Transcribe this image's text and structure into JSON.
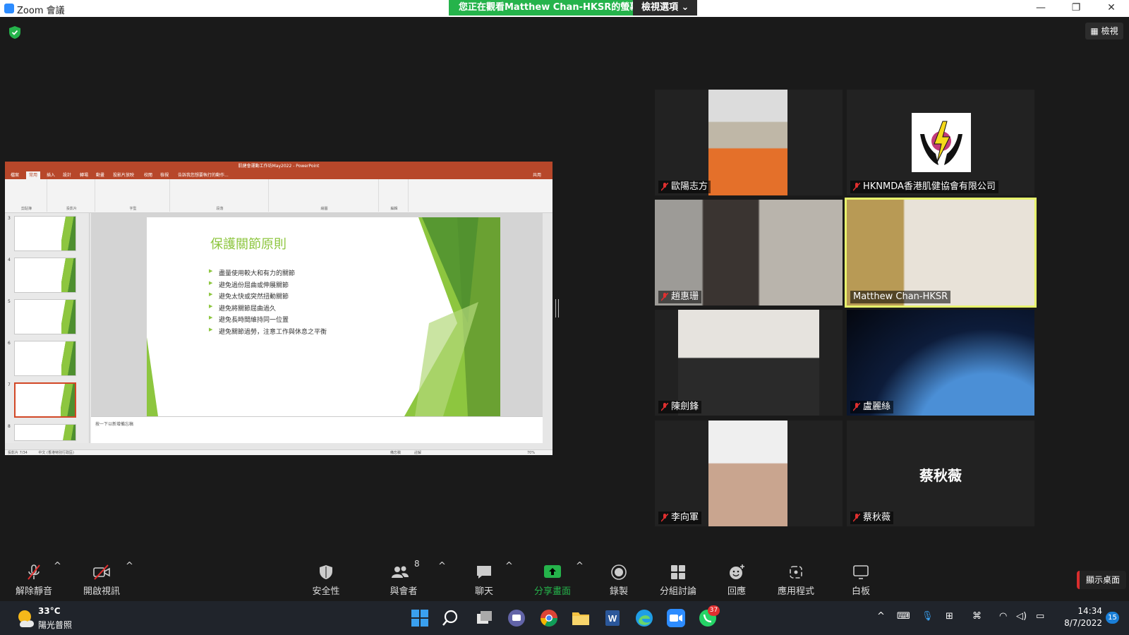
{
  "window": {
    "title": "Zoom 會議",
    "share_banner": "您正在觀看Matthew  Chan-HKSR的螢幕",
    "view_options": "檢視選項",
    "view_button": "檢視"
  },
  "shared_screen": {
    "window_title": "肌健會運動工作坊May2022 - PowerPoint",
    "tabs": [
      "檔案",
      "常用",
      "插入",
      "設計",
      "轉場",
      "動畫",
      "投影片放映",
      "校閱",
      "檢視"
    ],
    "active_tab": "常用",
    "tell_me": "告訴我您想要執行的動作...",
    "share_label": "共用",
    "ribbon_groups": [
      "剪貼簿",
      "投影片",
      "字型",
      "段落",
      "繪圖",
      "編輯"
    ],
    "slide_numbers": [
      "3",
      "4",
      "5",
      "6",
      "7",
      "8"
    ],
    "selected_slide": "7",
    "slide": {
      "title": "保護關節原則",
      "bullets": [
        "盡量使用較大和有力的關節",
        "避免過份屈曲或伸展關節",
        "避免太快或突然扭動關節",
        "避免將關節屈曲過久",
        "避免長時間維持同一位置",
        "避免關節過勞，注意工作與休息之平衡"
      ]
    },
    "notes_placeholder": "按一下以新增備忘稿",
    "status_left": "投影片 7/34",
    "status_lang": "中文 (香港特別行政區)",
    "status_notes": "備忘稿",
    "status_comments": "註解",
    "zoom_level": "70%"
  },
  "participants": [
    {
      "name": "歐陽志方",
      "muted": true,
      "video": true
    },
    {
      "name": "HKNMDA香港肌健協會有限公司",
      "muted": true,
      "video": false
    },
    {
      "name": "趙惠珊",
      "muted": true,
      "video": true
    },
    {
      "name": "Matthew Chan-HKSR",
      "muted": false,
      "video": true,
      "active": true
    },
    {
      "name": "陳劍鋒",
      "muted": true,
      "video": true
    },
    {
      "name": "盧麗絲",
      "muted": true,
      "video": true
    },
    {
      "name": "李向軍",
      "muted": true,
      "video": true
    },
    {
      "name": "蔡秋薇",
      "muted": true,
      "video": false,
      "display_name": "蔡秋薇"
    }
  ],
  "toolbar": {
    "unmute": "解除靜音",
    "start_video": "開啟視訊",
    "security": "安全性",
    "participants": "與會者",
    "participants_count": "8",
    "chat": "聊天",
    "share_screen": "分享畫面",
    "record": "錄製",
    "breakout": "分組討論",
    "reactions": "回應",
    "apps": "應用程式",
    "whiteboard": "白板",
    "show_desktop": "顯示桌面"
  },
  "taskbar": {
    "temperature": "33°C",
    "weather": "陽光普照",
    "whatsapp_badge": "37",
    "time": "14:34",
    "date": "8/7/2022",
    "notifications": "15"
  },
  "colors": {
    "zoom_blue": "#2d8cff",
    "share_green": "#25b34b",
    "powerpoint_red": "#b7472a",
    "slide_green": "#8dc63f",
    "active_speaker": "#e7f26c",
    "muted_red": "#e02f2f"
  }
}
